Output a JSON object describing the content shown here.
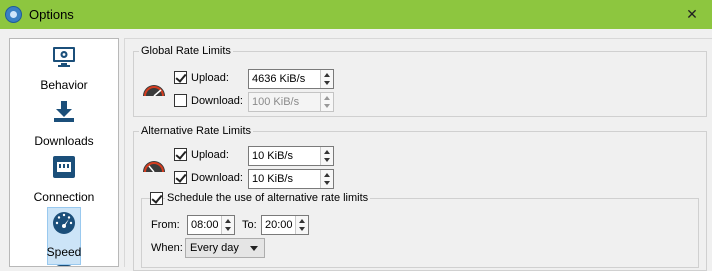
{
  "window": {
    "title": "Options"
  },
  "sidebar": {
    "items": [
      {
        "label": "Behavior",
        "icon": "monitor-gear-icon"
      },
      {
        "label": "Downloads",
        "icon": "download-icon"
      },
      {
        "label": "Connection",
        "icon": "network-icon"
      },
      {
        "label": "Speed",
        "icon": "speedometer-icon",
        "selected": true
      }
    ]
  },
  "global": {
    "title": "Global Rate Limits",
    "upload": {
      "label": "Upload:",
      "checked": true,
      "value": "4636 KiB/s"
    },
    "download": {
      "label": "Download:",
      "checked": false,
      "value": "100 KiB/s"
    }
  },
  "alt": {
    "title": "Alternative Rate Limits",
    "upload": {
      "label": "Upload:",
      "checked": true,
      "value": "10 KiB/s"
    },
    "download": {
      "label": "Download:",
      "checked": true,
      "value": "10 KiB/s"
    },
    "schedule": {
      "label": "Schedule the use of alternative rate limits",
      "checked": true,
      "from_label": "From:",
      "from_value": "08:00",
      "to_label": "To:",
      "to_value": "20:00",
      "when_label": "When:",
      "when_value": "Every day"
    }
  },
  "colors": {
    "titlebar": "#8dc63f",
    "selected_bg": "#cce4f7",
    "icon_blue": "#1b4f7a"
  }
}
